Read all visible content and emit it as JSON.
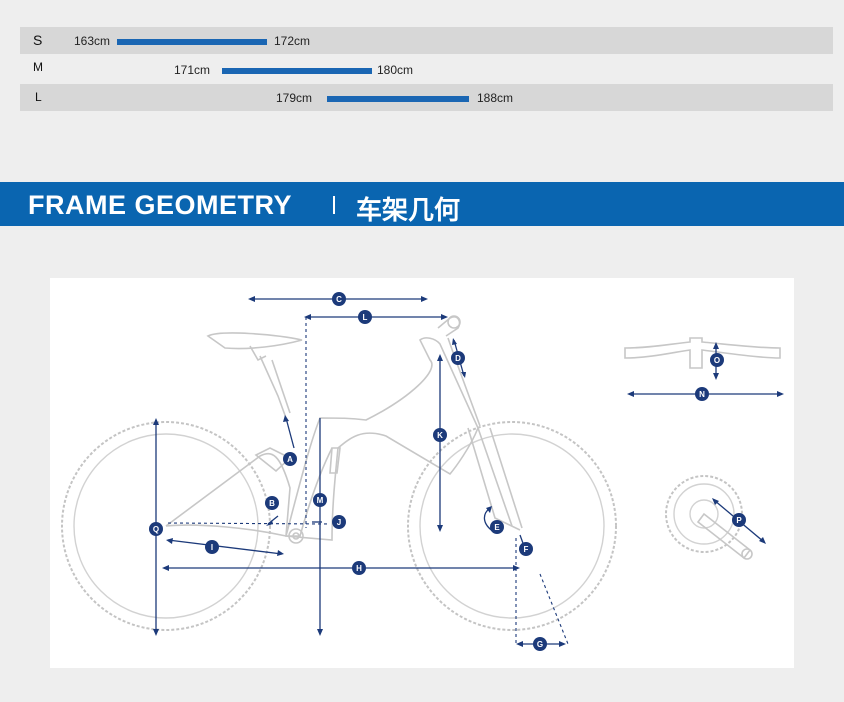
{
  "size_chart": [
    {
      "size": "S",
      "min": "163cm",
      "max": "172cm"
    },
    {
      "size": "M",
      "min": "171cm",
      "max": "180cm"
    },
    {
      "size": "L",
      "min": "179cm",
      "max": "188cm"
    }
  ],
  "banner": {
    "title": "FRAME GEOMETRY",
    "separator": "|",
    "title_cn": "车架几何"
  },
  "geometry_labels": {
    "A": "A",
    "B": "B",
    "C": "C",
    "D": "D",
    "E": "E",
    "F": "F",
    "G": "G",
    "H": "H",
    "I": "I",
    "J": "J",
    "K": "K",
    "L": "L",
    "M": "M",
    "N": "N",
    "O": "O",
    "P": "P",
    "Q": "Q"
  },
  "colors": {
    "accent": "#0a65b0",
    "bar": "#1a66b3",
    "dimension": "#1c3a7a",
    "frame_line": "#c7c7c7"
  }
}
